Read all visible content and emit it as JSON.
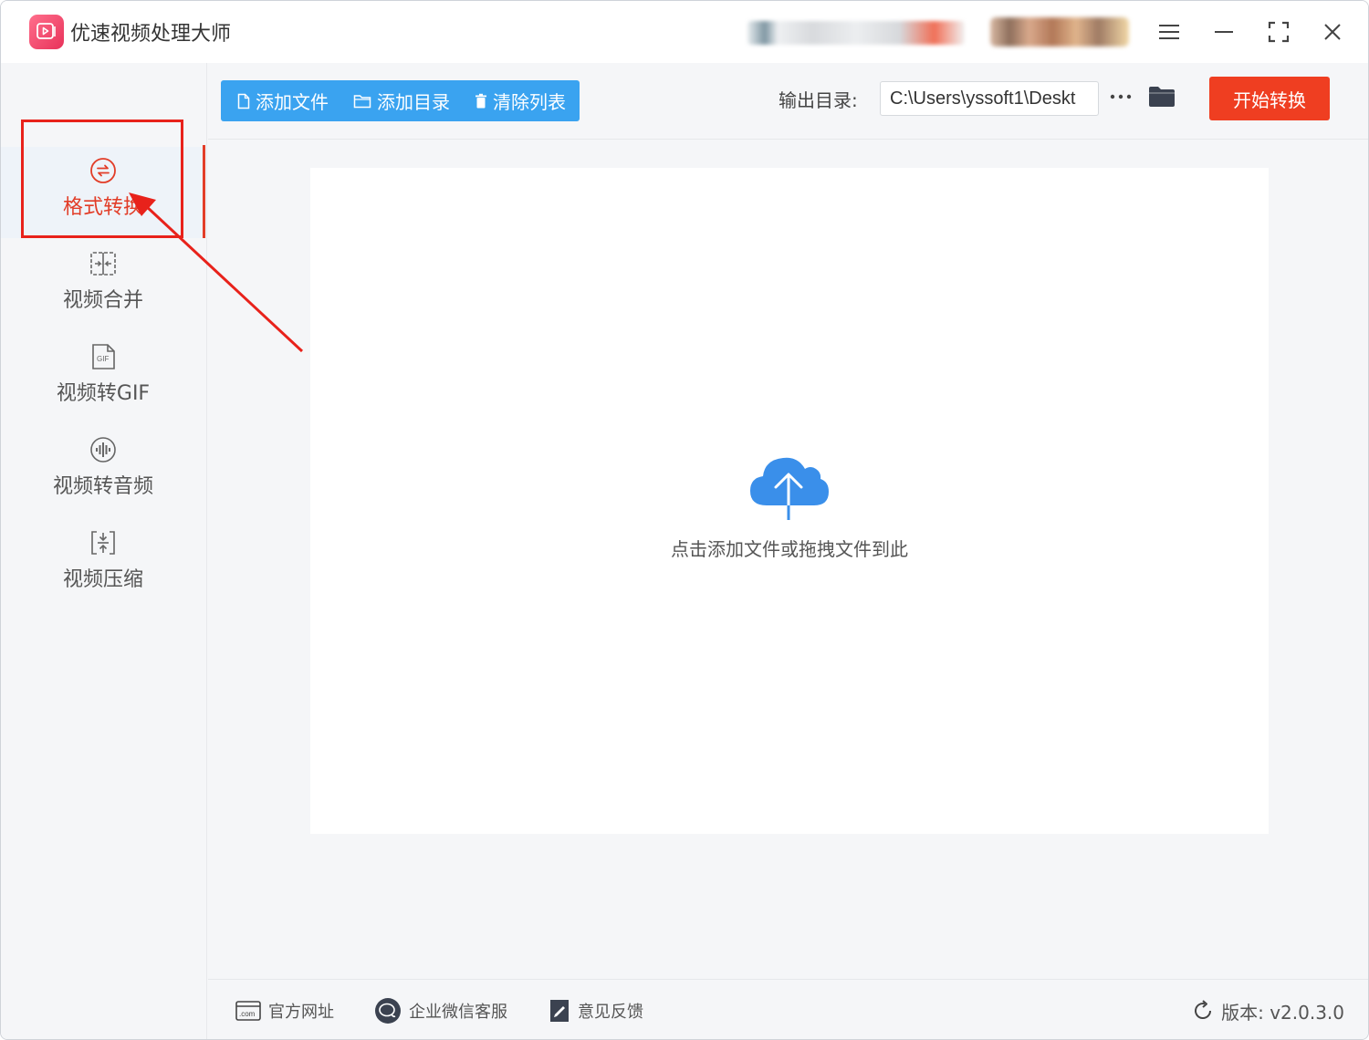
{
  "app": {
    "title": "优速视频处理大师"
  },
  "sidebar": {
    "items": [
      {
        "label": "格式转换",
        "icon": "format-convert-icon",
        "active": true
      },
      {
        "label": "视频合并",
        "icon": "video-merge-icon",
        "active": false
      },
      {
        "label": "视频转GIF",
        "icon": "gif-icon",
        "active": false
      },
      {
        "label": "视频转音频",
        "icon": "audio-icon",
        "active": false
      },
      {
        "label": "视频压缩",
        "icon": "compress-icon",
        "active": false
      }
    ]
  },
  "toolbar": {
    "add_file": "添加文件",
    "add_folder": "添加目录",
    "clear_list": "清除列表",
    "output_label": "输出目录:",
    "output_path": "C:\\Users\\yssoft1\\Deskt",
    "start": "开始转换"
  },
  "dropzone": {
    "hint": "点击添加文件或拖拽文件到此"
  },
  "footer": {
    "website": "官方网址",
    "wechat": "企业微信客服",
    "feedback": "意见反馈",
    "version": "版本: v2.0.3.0"
  },
  "colors": {
    "accent_blue": "#3aa3f0",
    "accent_red": "#ef3e21",
    "annotation_red": "#e8221b"
  }
}
